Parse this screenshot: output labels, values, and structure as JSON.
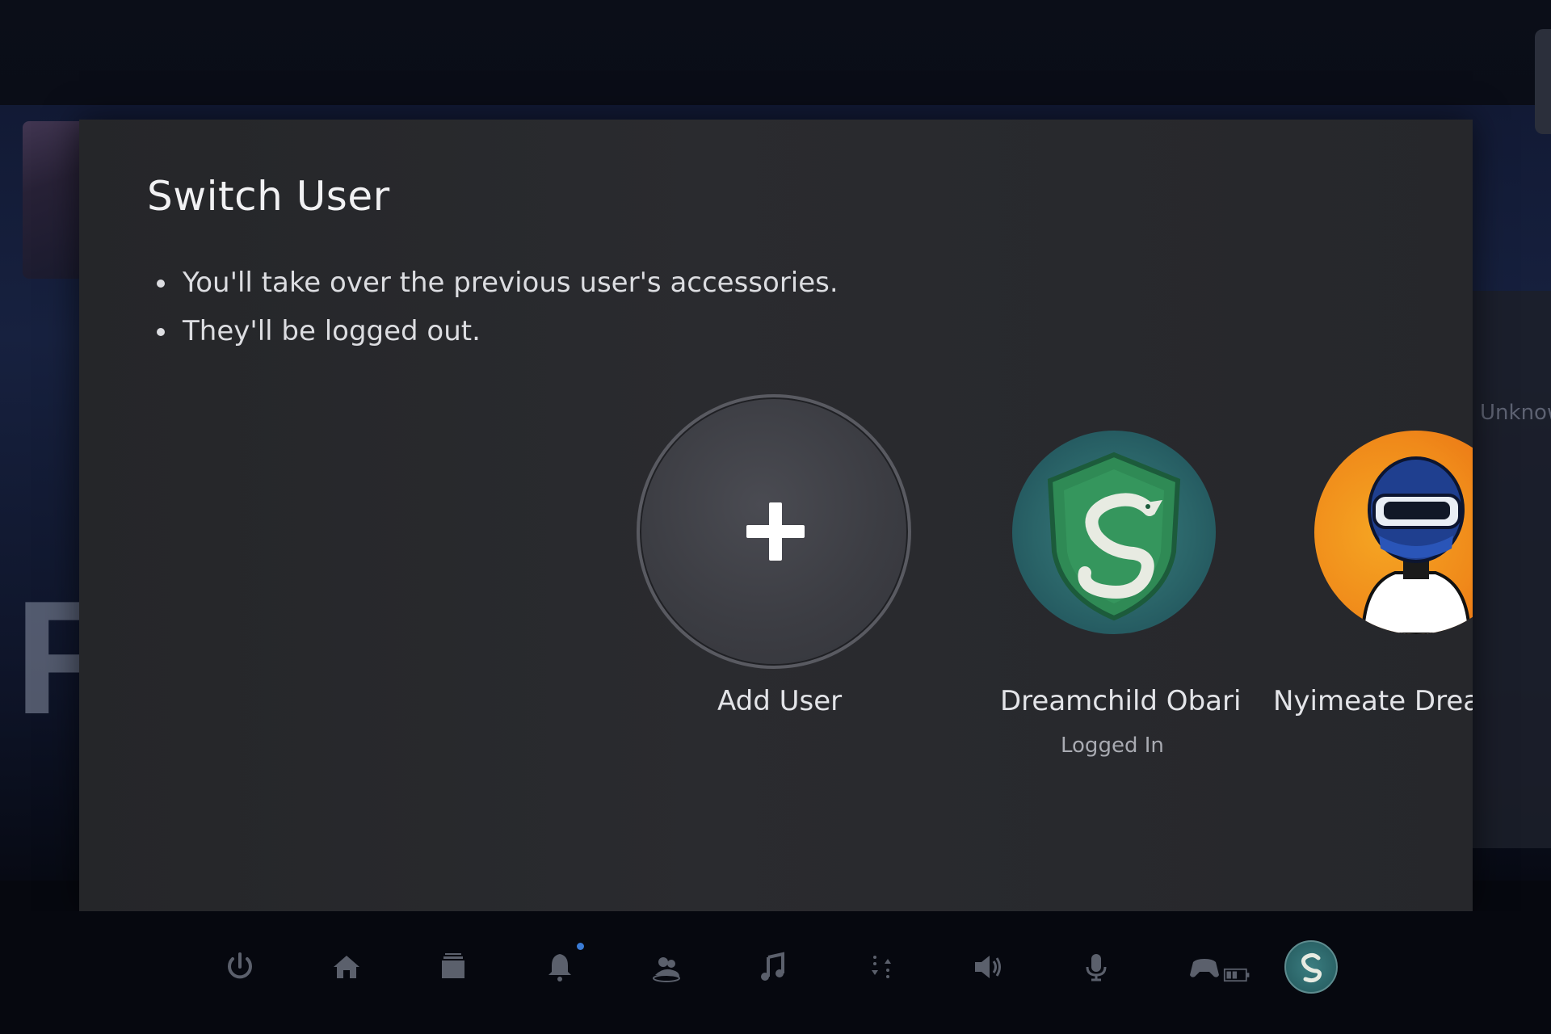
{
  "background": {
    "game_title_fragment": "F",
    "side_panel_text": "Unknow"
  },
  "dialog": {
    "title": "Switch User",
    "bullets": [
      "You'll take over the previous user's accessories.",
      "They'll be logged out."
    ]
  },
  "users": [
    {
      "name": "Add User",
      "status": "",
      "icon": "plus-icon"
    },
    {
      "name": "Dreamchild Obari",
      "status": "Logged In",
      "icon": "serpent-crest-avatar"
    },
    {
      "name": "Nyimeate Drear",
      "status": "",
      "icon": "helmet-rider-avatar"
    }
  ],
  "control_center": {
    "items": [
      "power-icon",
      "home-icon",
      "game-base-icon",
      "notifications-icon",
      "game-base-friends-icon",
      "music-icon",
      "switcher-icon",
      "sound-icon",
      "microphone-icon",
      "controller-icon",
      "profile-avatar"
    ]
  },
  "colors": {
    "dialog_bg": "#28292d",
    "accent_notification": "#3a7bd5",
    "avatar_crest_green": "#2a6468",
    "avatar_orange": "#f08a1a"
  }
}
